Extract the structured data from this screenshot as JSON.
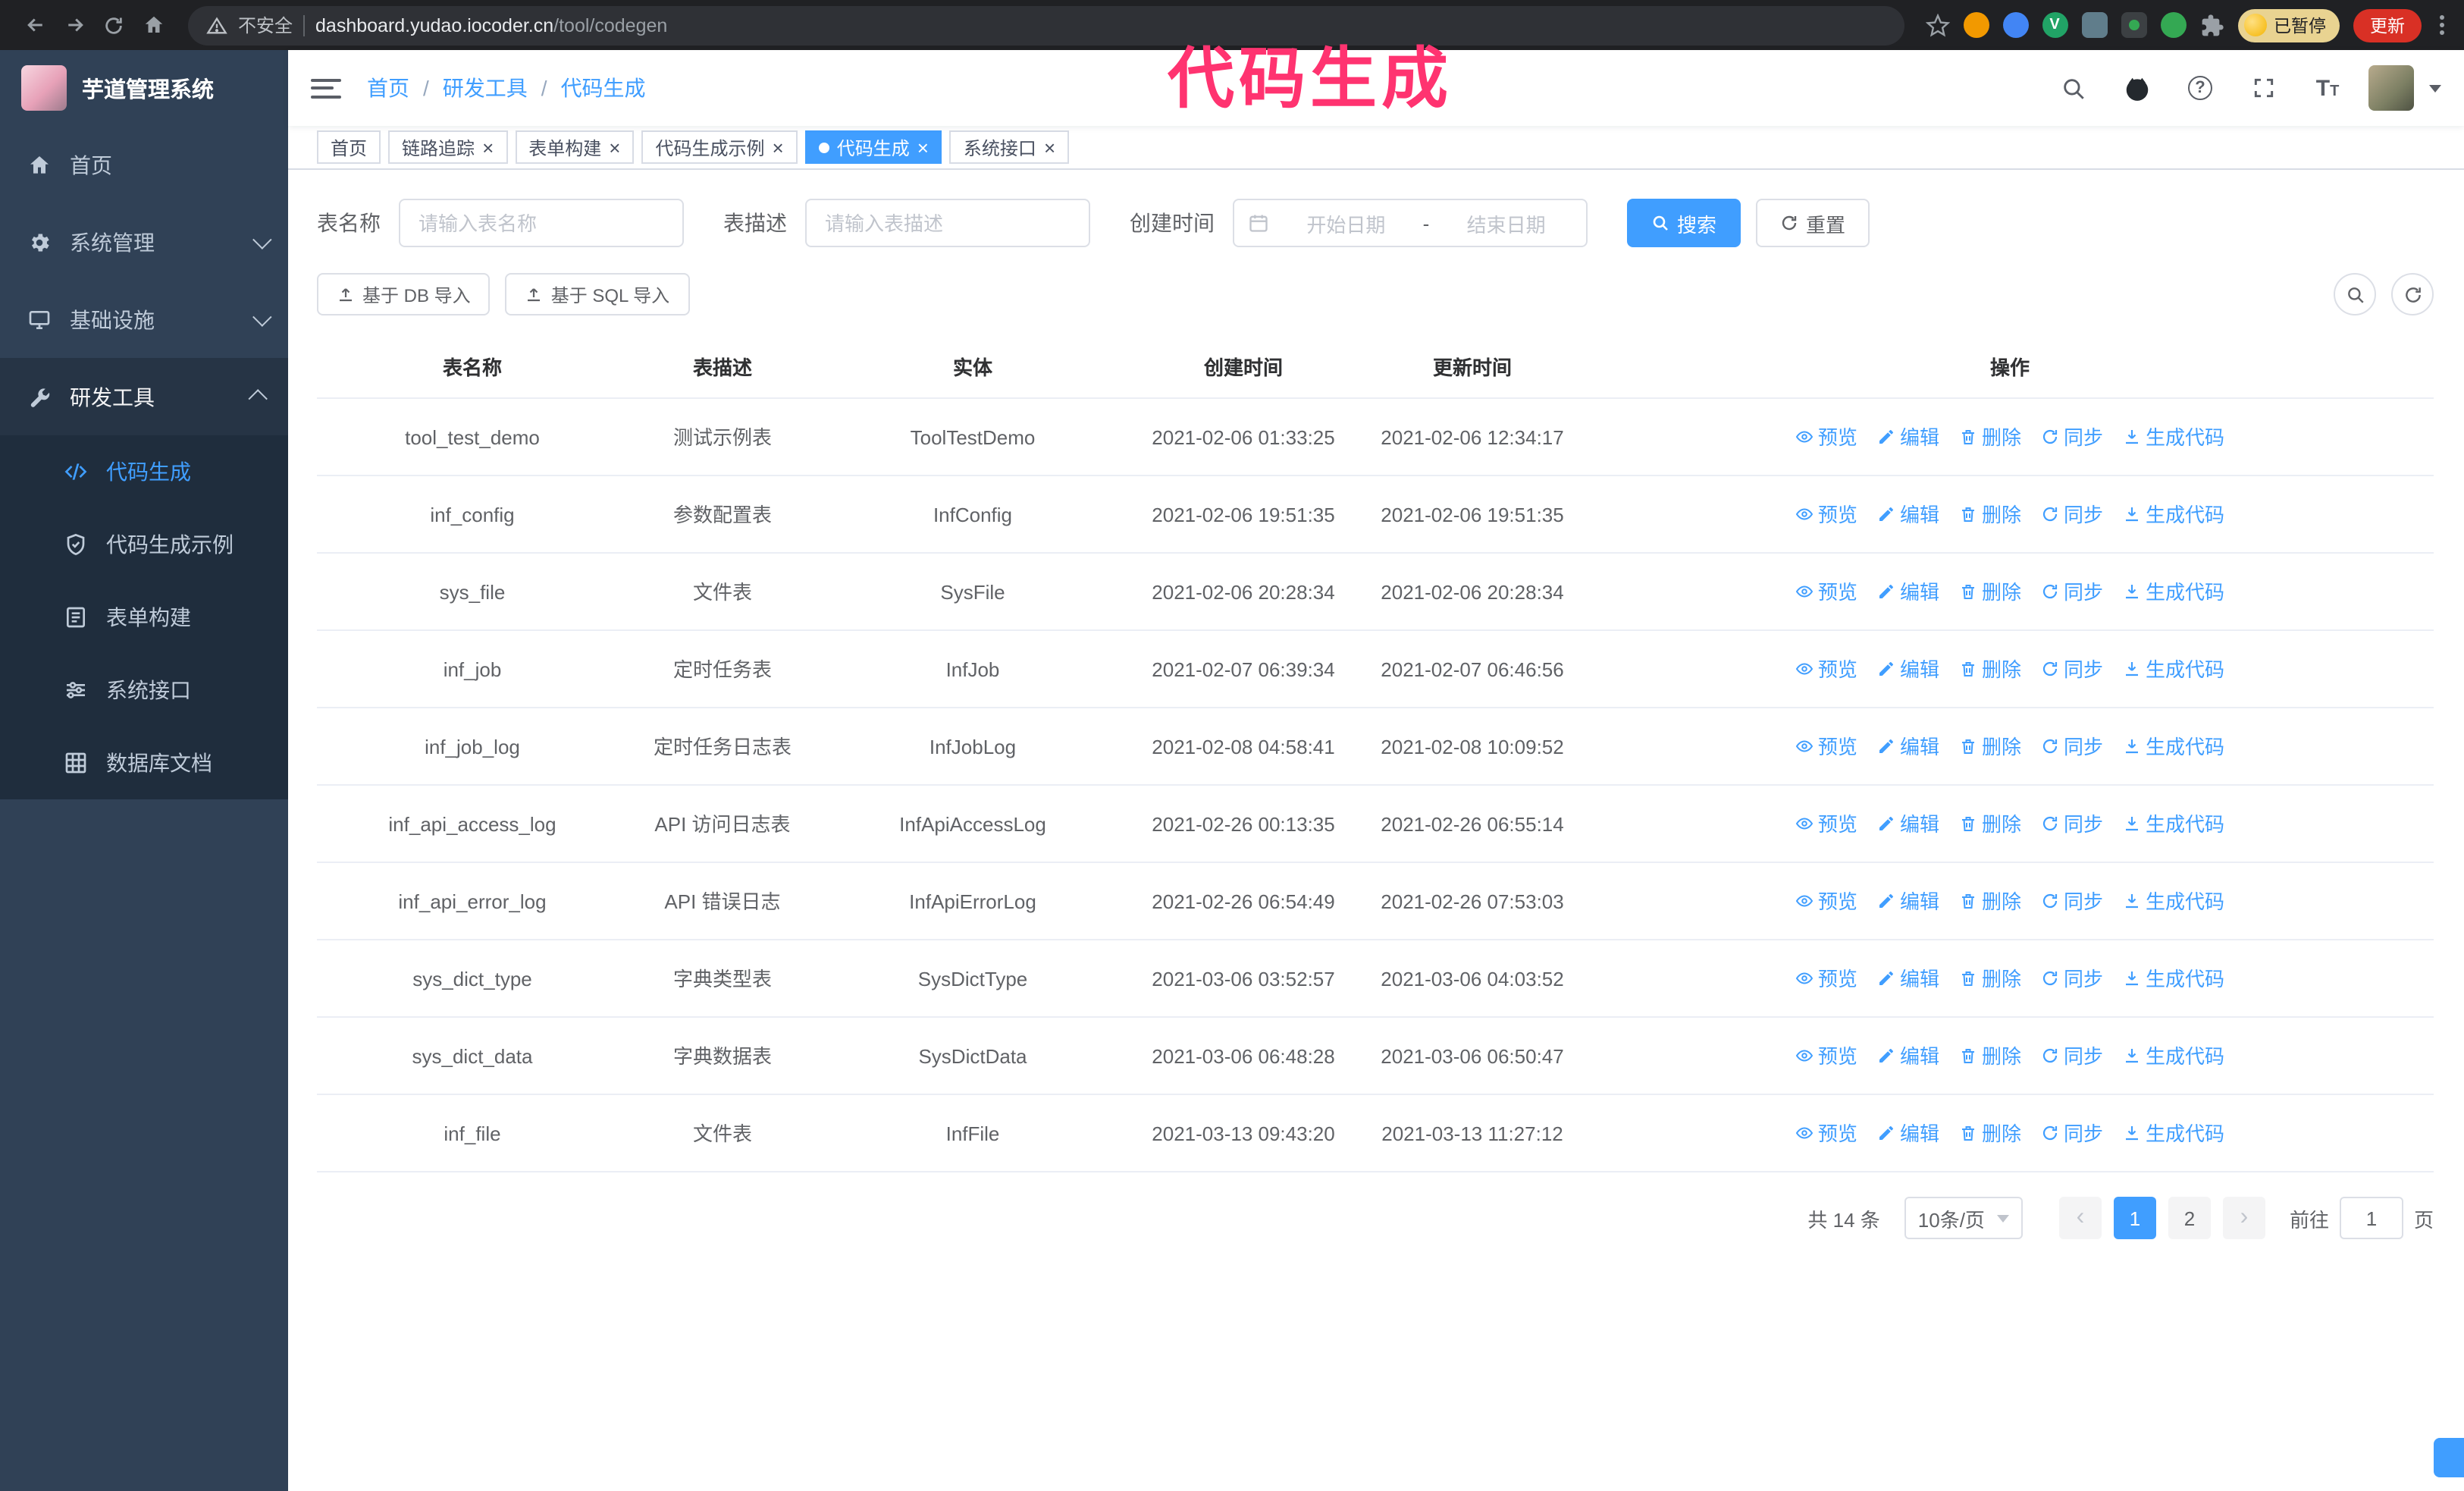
{
  "annotation": {
    "text": "代码生成"
  },
  "browser": {
    "security_label": "不安全",
    "url_host": "dashboard.yudao.iocoder.cn",
    "url_path": "/tool/codegen",
    "profile_badge": "已暂停",
    "update_button": "更新"
  },
  "sidebar": {
    "logo_title": "芋道管理系统",
    "items": [
      {
        "label": "首页"
      },
      {
        "label": "系统管理"
      },
      {
        "label": "基础设施"
      },
      {
        "label": "研发工具"
      }
    ],
    "sub_items": [
      {
        "label": "代码生成"
      },
      {
        "label": "代码生成示例"
      },
      {
        "label": "表单构建"
      },
      {
        "label": "系统接口"
      },
      {
        "label": "数据库文档"
      }
    ]
  },
  "breadcrumb": {
    "items": [
      "首页",
      "研发工具",
      "代码生成"
    ],
    "separator": "/"
  },
  "tabs": [
    {
      "label": "首页"
    },
    {
      "label": "链路追踪"
    },
    {
      "label": "表单构建"
    },
    {
      "label": "代码生成示例"
    },
    {
      "label": "代码生成"
    },
    {
      "label": "系统接口"
    }
  ],
  "filters": {
    "table_name_label": "表名称",
    "table_name_placeholder": "请输入表名称",
    "table_desc_label": "表描述",
    "table_desc_placeholder": "请输入表描述",
    "create_time_label": "创建时间",
    "date_start_placeholder": "开始日期",
    "date_separator": "-",
    "date_end_placeholder": "结束日期",
    "search_button": "搜索",
    "reset_button": "重置"
  },
  "toolbar": {
    "import_db_button": "基于 DB 导入",
    "import_sql_button": "基于 SQL 导入"
  },
  "table": {
    "columns": [
      "表名称",
      "表描述",
      "实体",
      "创建时间",
      "更新时间",
      "操作"
    ],
    "actions": [
      "预览",
      "编辑",
      "删除",
      "同步",
      "生成代码"
    ],
    "rows": [
      {
        "name": "tool_test_demo",
        "desc": "测试示例表",
        "entity": "ToolTestDemo",
        "created": "2021-02-06 01:33:25",
        "updated": "2021-02-06 12:34:17"
      },
      {
        "name": "inf_config",
        "desc": "参数配置表",
        "entity": "InfConfig",
        "created": "2021-02-06 19:51:35",
        "updated": "2021-02-06 19:51:35"
      },
      {
        "name": "sys_file",
        "desc": "文件表",
        "entity": "SysFile",
        "created": "2021-02-06 20:28:34",
        "updated": "2021-02-06 20:28:34"
      },
      {
        "name": "inf_job",
        "desc": "定时任务表",
        "entity": "InfJob",
        "created": "2021-02-07 06:39:34",
        "updated": "2021-02-07 06:46:56"
      },
      {
        "name": "inf_job_log",
        "desc": "定时任务日志表",
        "entity": "InfJobLog",
        "created": "2021-02-08 04:58:41",
        "updated": "2021-02-08 10:09:52"
      },
      {
        "name": "inf_api_access_log",
        "desc": "API 访问日志表",
        "entity": "InfApiAccessLog",
        "created": "2021-02-26 00:13:35",
        "updated": "2021-02-26 06:55:14"
      },
      {
        "name": "inf_api_error_log",
        "desc": "API 错误日志",
        "entity": "InfApiErrorLog",
        "created": "2021-02-26 06:54:49",
        "updated": "2021-02-26 07:53:03"
      },
      {
        "name": "sys_dict_type",
        "desc": "字典类型表",
        "entity": "SysDictType",
        "created": "2021-03-06 03:52:57",
        "updated": "2021-03-06 04:03:52"
      },
      {
        "name": "sys_dict_data",
        "desc": "字典数据表",
        "entity": "SysDictData",
        "created": "2021-03-06 06:48:28",
        "updated": "2021-03-06 06:50:47"
      },
      {
        "name": "inf_file",
        "desc": "文件表",
        "entity": "InfFile",
        "created": "2021-03-13 09:43:20",
        "updated": "2021-03-13 11:27:12"
      }
    ]
  },
  "pagination": {
    "total_text": "共 14 条",
    "page_size_text": "10条/页",
    "prev": "‹",
    "next": "›",
    "pages": [
      "1",
      "2"
    ],
    "goto_prefix": "前往",
    "goto_value": "1",
    "goto_suffix": "页"
  }
}
